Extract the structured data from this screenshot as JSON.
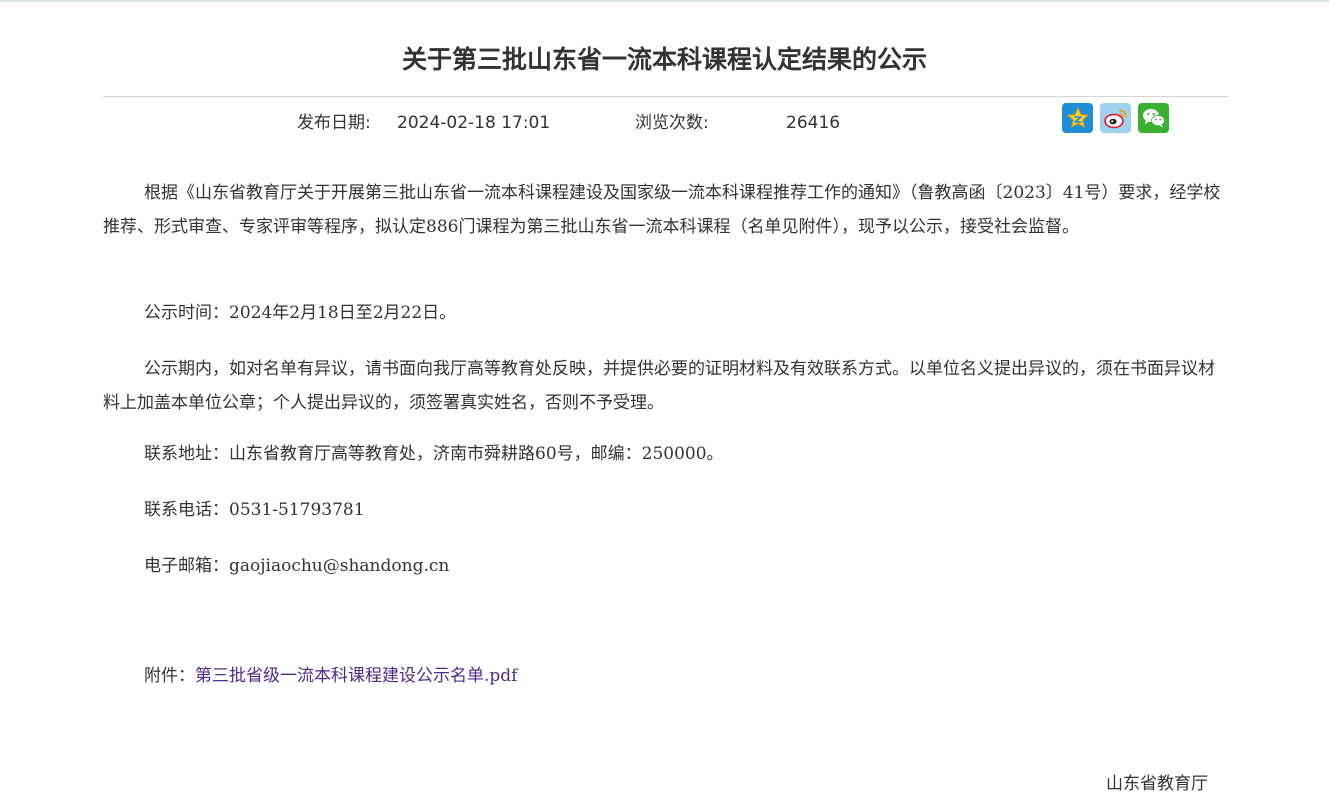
{
  "article": {
    "title": "关于第三批山东省一流本科课程认定结果的公示",
    "publish_label": "发布日期:",
    "publish_date": "2024-02-18 17:01",
    "views_label": "浏览次数:",
    "views_count": "26416"
  },
  "share": {
    "icons": [
      "star-icon",
      "weibo-icon",
      "wechat-icon"
    ],
    "colors": {
      "qzone": "#1e8ed8",
      "weibo": "#9ed2ef",
      "wechat": "#38b130"
    }
  },
  "body": {
    "intro": "根据《山东省教育厅关于开展第三批山东省一流本科课程建设及国家级一流本科课程推荐工作的通知》（鲁教高函〔2023〕41号）要求，经学校推荐、形式审查、专家评审等程序，拟认定886门课程为第三批山东省一流本科课程（名单见附件），现予以公示，接受社会监督。",
    "period": "公示时间：2024年2月18日至2月22日。",
    "objection": "公示期内，如对名单有异议，请书面向我厅高等教育处反映，并提供必要的证明材料及有效联系方式。以单位名义提出异议的，须在书面异议材料上加盖本单位公章；个人提出异议的，须签署真实姓名，否则不予受理。",
    "address": "联系地址：山东省教育厅高等教育处，济南市舜耕路60号，邮编：250000。",
    "phone": "联系电话：0531-51793781",
    "email": "电子邮箱：gaojiaochu@shandong.cn",
    "attachment_label": "附件：",
    "attachment_link": "第三批省级一流本科课程建设公示名单.pdf",
    "link_color": "#4e2a8e"
  },
  "signature": "山东省教育厅"
}
